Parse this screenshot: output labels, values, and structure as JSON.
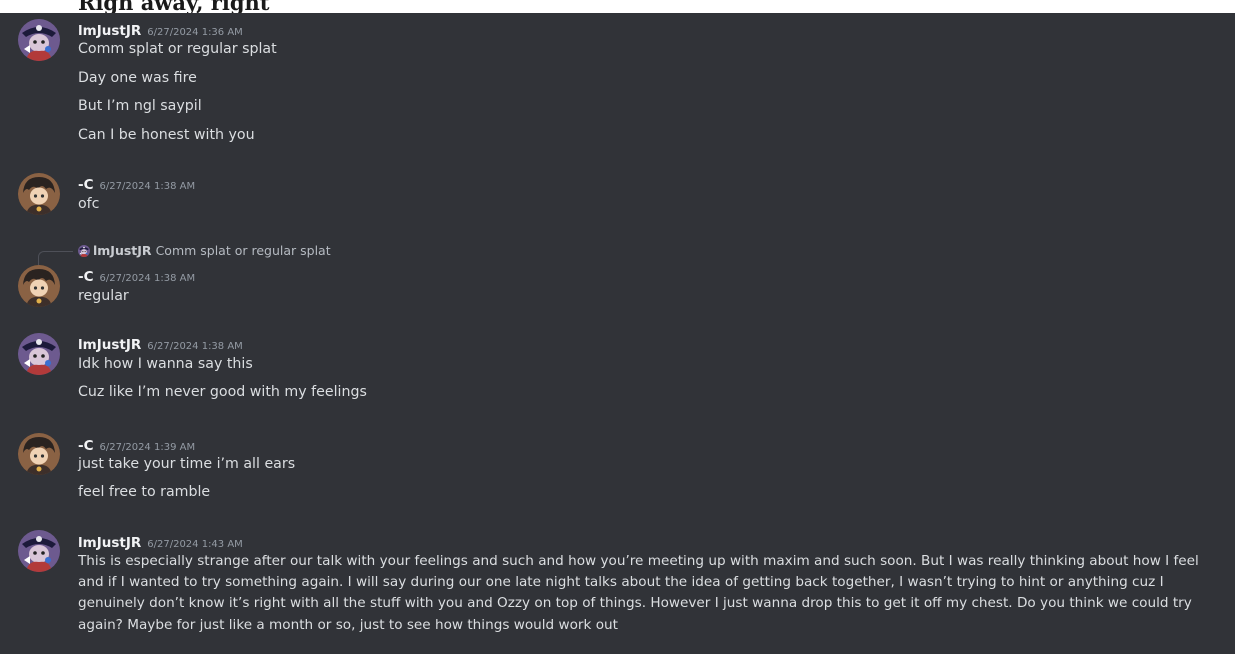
{
  "top_bar": {
    "text": "Righ away, right"
  },
  "messages": [
    {
      "author": "lmJustJR",
      "timestamp": "6/27/2024 1:36 AM",
      "lines": [
        "Comm splat or regular splat",
        "Day one was fire",
        "But I’m ngl saypil",
        "Can I be honest with you"
      ]
    },
    {
      "author": "-C",
      "timestamp": "6/27/2024 1:38 AM",
      "lines": [
        "ofc"
      ]
    },
    {
      "reply_to": {
        "author": "lmJustJR",
        "text": "Comm splat or regular splat"
      },
      "author": "-C",
      "timestamp": "6/27/2024 1:38 AM",
      "lines": [
        "regular"
      ]
    },
    {
      "author": "lmJustJR",
      "timestamp": "6/27/2024 1:38 AM",
      "lines": [
        "Idk how I wanna say this",
        "Cuz like I’m never good with my feelings"
      ]
    },
    {
      "author": "-C",
      "timestamp": "6/27/2024 1:39 AM",
      "lines": [
        "just take your time i’m all ears",
        "feel free to ramble"
      ]
    },
    {
      "author": "lmJustJR",
      "timestamp": "6/27/2024 1:43 AM",
      "lines": [
        "This is especially strange after our talk with your feelings and such and how you’re meeting up with maxim and such soon. But I was really thinking about how I feel and if I wanted to try something again. I will say during our one late night talks about the idea of getting back together, I wasn’t trying to hint or anything cuz I genuinely don’t know it’s right with all the stuff with you and Ozzy on top of things. However I just wanna drop this to get it off my chest. Do you think we could try again? Maybe for just like a month or so, just to see how things would work out"
      ]
    }
  ],
  "colors": {
    "background": "#313338",
    "username": "#f2f3f5",
    "timestamp": "#949ba4",
    "message_text": "#dbdee1",
    "reply_text": "#b5bac1"
  },
  "icons": [
    "user-avatar-lmjustjr",
    "user-avatar-c",
    "reply-spine"
  ]
}
